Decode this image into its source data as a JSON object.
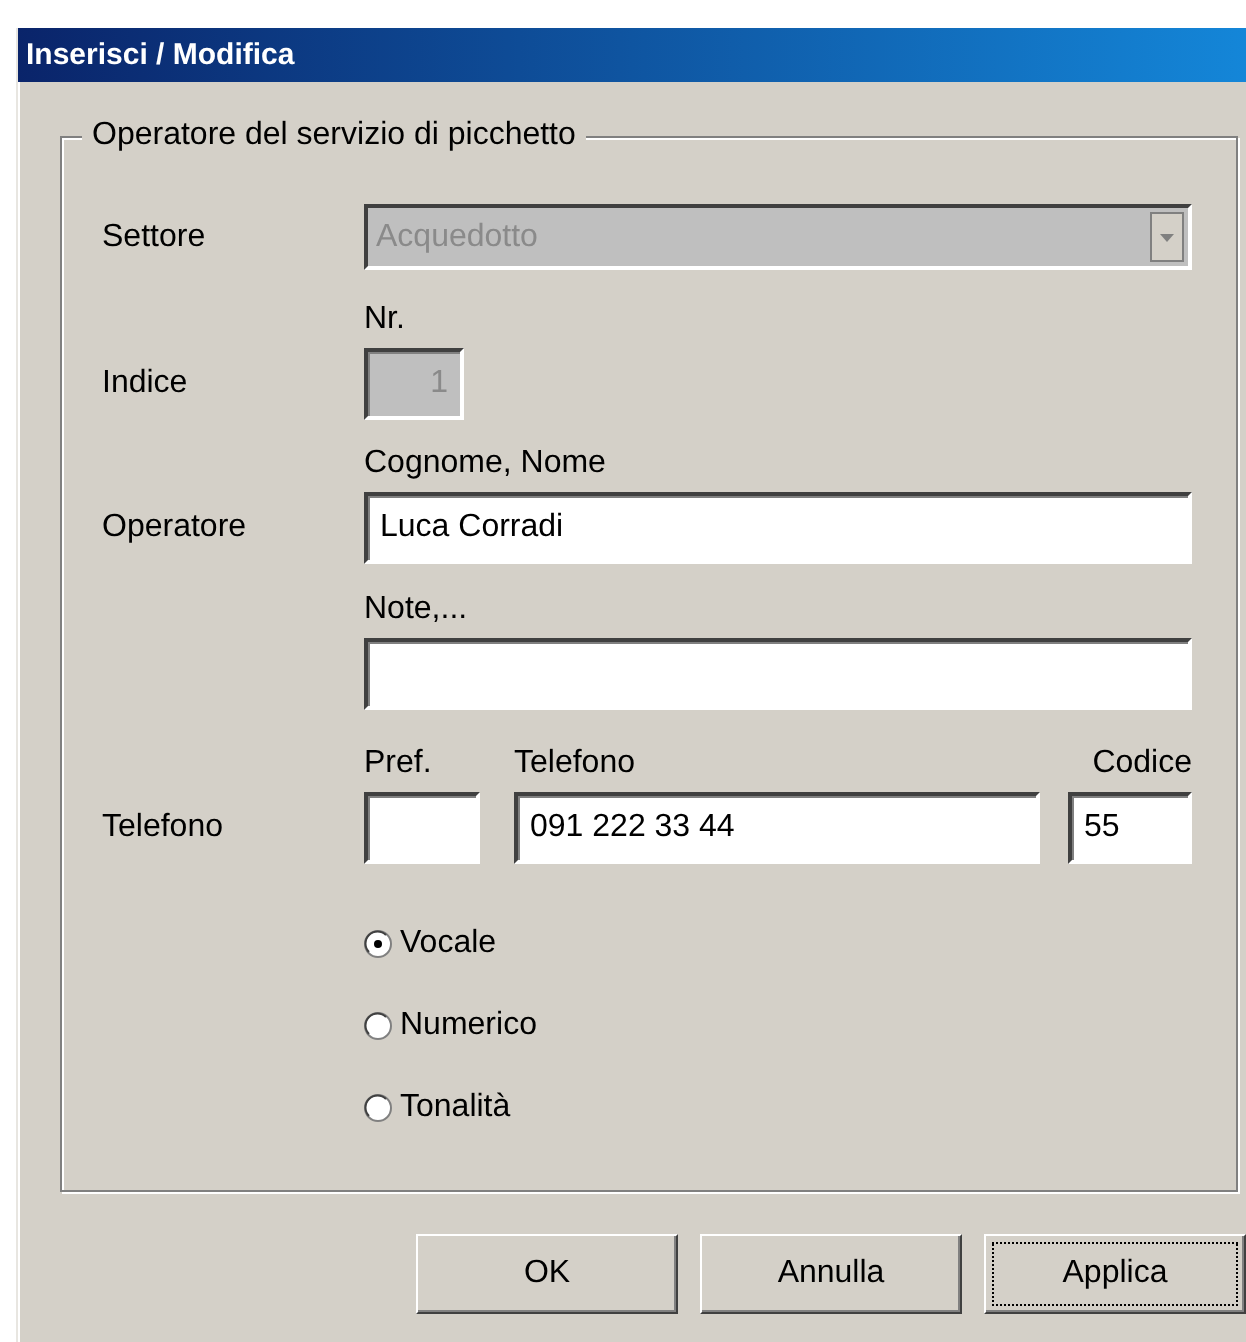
{
  "window": {
    "title": "Inserisci / Modifica"
  },
  "group": {
    "title": "Operatore del servizio di picchetto"
  },
  "settore": {
    "label": "Settore",
    "value": "Acquedotto",
    "disabled": true
  },
  "indice": {
    "label": "Indice",
    "caption": "Nr.",
    "value": "1",
    "disabled": true
  },
  "operatore": {
    "label": "Operatore",
    "fields": [
      {
        "caption": "Cognome, Nome",
        "value": "Luca Corradi"
      },
      {
        "caption": "Note,..."
      }
    ]
  },
  "telefono": {
    "label": "Telefono",
    "fields": [
      {
        "caption": "Pref."
      },
      {
        "caption": "Telefono",
        "value": "091 222 33 44"
      },
      {
        "caption": "Codice",
        "value": "55"
      }
    ]
  },
  "modes": [
    {
      "label": "Vocale",
      "selected": true
    },
    {
      "label": "Numerico",
      "selected": false
    },
    {
      "label": "Tonalità",
      "selected": false
    }
  ],
  "buttons": [
    {
      "label": "OK",
      "focused": false
    },
    {
      "label": "Annulla",
      "focused": false
    },
    {
      "label": "Applica",
      "focused": true
    }
  ]
}
